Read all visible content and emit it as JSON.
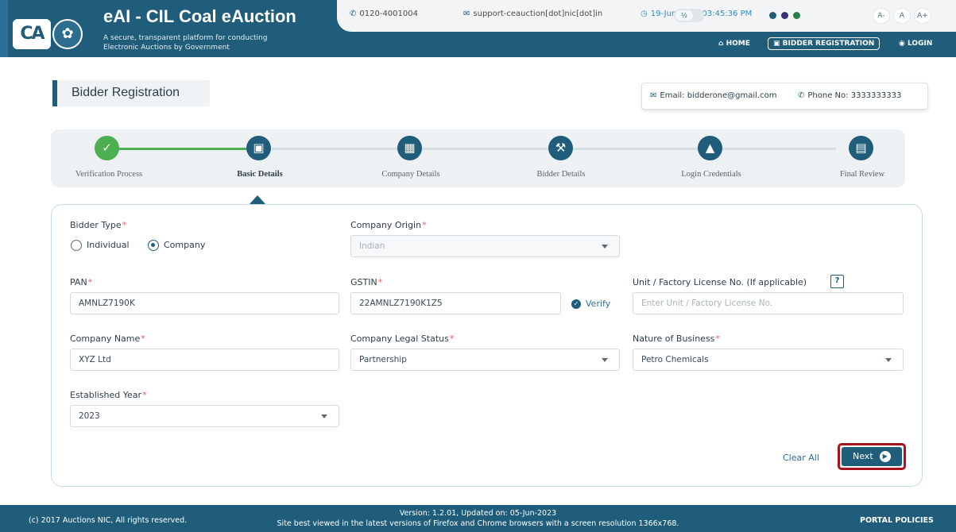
{
  "header": {
    "logo_text": "CA",
    "title": "eAI - CIL Coal eAuction",
    "subtitle": "A secure, transparent platform for conducting Electronic Auctions by Government",
    "phone": "0120-4001004",
    "email": "support-ceauction[dot]nic[dot]in",
    "datetime": "19-Jun-2023 03:45:36 PM",
    "theme_dots": [
      "#1f5d7a",
      "#3a2f7d",
      "#2d7d4a"
    ],
    "contrast_toggle": "½",
    "font_sizes": [
      "A-",
      "A",
      "A+"
    ],
    "nav": {
      "home": "HOME",
      "bidder_registration": "BIDDER REGISTRATION",
      "login": "LOGIN"
    }
  },
  "page": {
    "title": "Bidder Registration",
    "contact_email_label": "Email:",
    "contact_email": "bidderone@gmail.com",
    "contact_phone_label": "Phone No:",
    "contact_phone": "3333333333"
  },
  "stepper": {
    "steps": [
      {
        "label": "Verification Process",
        "icon": "check-icon",
        "state": "done"
      },
      {
        "label": "Basic Details",
        "icon": "id-card-icon",
        "state": "active"
      },
      {
        "label": "Company Details",
        "icon": "building-icon",
        "state": "pending"
      },
      {
        "label": "Bidder Details",
        "icon": "gavel-icon",
        "state": "pending"
      },
      {
        "label": "Login Credentials",
        "icon": "lock-icon",
        "state": "pending"
      },
      {
        "label": "Final Review",
        "icon": "review-icon",
        "state": "pending"
      }
    ]
  },
  "form": {
    "bidder_type_label": "Bidder Type",
    "bidder_type_options": [
      "Individual",
      "Company"
    ],
    "bidder_type_selected": "Company",
    "company_origin_label": "Company Origin",
    "company_origin_value": "Indian",
    "pan_label": "PAN",
    "pan_value": "AMNLZ7190K",
    "gstin_label": "GSTIN",
    "gstin_value": "22AMNLZ7190K1Z5",
    "verify_label": "Verify",
    "license_label": "Unit / Factory License No. (If applicable)",
    "license_help": "?",
    "license_placeholder": "Enter Unit / Factory License No.",
    "company_name_label": "Company Name",
    "company_name_value": "XYZ Ltd",
    "legal_status_label": "Company Legal Status",
    "legal_status_value": "Partnership",
    "nature_label": "Nature of Business",
    "nature_value": "Petro Chemicals",
    "established_label": "Established Year",
    "established_value": "2023",
    "clear_all": "Clear All",
    "next": "Next",
    "required_mark": "*"
  },
  "footer": {
    "copyright": "(c) 2017 Auctions NIC, All rights reserved.",
    "version": "Version: 1.2.01, Updated on: 05-Jun-2023",
    "browser_note": "Site best viewed in the latest versions of Firefox and Chrome browsers with a screen resolution 1366x768.",
    "policies": "PORTAL POLICIES"
  }
}
